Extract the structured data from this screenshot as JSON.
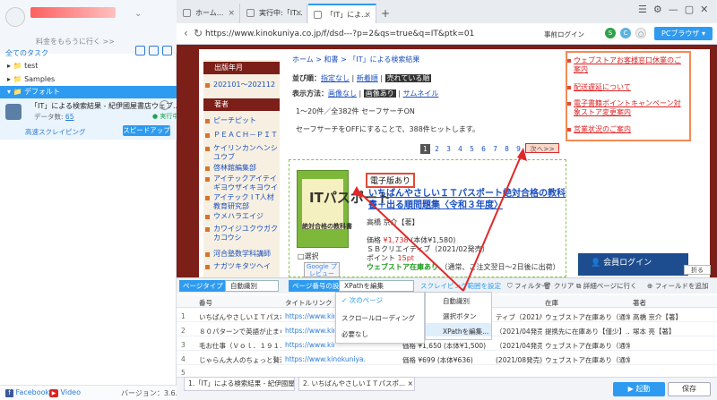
{
  "sidebar": {
    "promo": "料金をもらうに行く >>",
    "section_title": "全てのタスク",
    "tree": [
      {
        "label": "▸ 📁 test"
      },
      {
        "label": "▸ 📁 Samples"
      },
      {
        "label": "▾ 📁 デフォルト"
      }
    ],
    "task": {
      "title": "「IT」による検索結果 - 紀伊國屋書店ウェブ...",
      "count_label": "データ数:",
      "count": "65",
      "status": "● 実行中",
      "cloud": "高速スクレイピング",
      "speed_button": "スピードアップ"
    },
    "footer": {
      "facebook": "Facebook",
      "video": "Video",
      "version": "バージョン：3.6.1"
    }
  },
  "browser": {
    "tabs": [
      {
        "label": "ホーム..."
      },
      {
        "label": "実行中:「IT..."
      },
      {
        "label": "「IT」によ..."
      }
    ],
    "url": "https://www.kinokuniya.co.jp/f/dsd---?p=2&qs=true&q=IT&ptk=01",
    "login_label": "事前ログイン",
    "pc_browser": "PCブラウザ ▾"
  },
  "web": {
    "breadcrumb": "ホーム > 和書 > 「IT」による検索結果",
    "sort_label": "並び順：",
    "sort_items": [
      "指定なし",
      "新着順",
      "売れている順"
    ],
    "display_label": "表示方法：",
    "display_items": [
      "画像なし",
      "画像あり",
      "サムネイル"
    ],
    "range_text": "1〜20件／全382件  セーフサーチON",
    "safe_text": "セーフサーチをOFFにすることで、388件ヒットします。",
    "pager": [
      "1",
      "2",
      "3",
      "4",
      "5",
      "6",
      "7",
      "8",
      "9"
    ],
    "pager_next": "次へ>>",
    "categories": [
      {
        "heading": "出版年月",
        "links": [
          "202101〜202112"
        ]
      },
      {
        "heading": "著者",
        "links": [
          "ピーチピット",
          "ＰＥＡＣＨ－ＰＩＴ",
          "ケイリンカンヘンシユウブ",
          "啓林館編集部",
          "アイテックアイテイギヨウザイキヨウイ",
          "アイテック I T人材教育研究部",
          "ウメハラエイジ",
          "カワイジユクウガクカコウシ",
          "河合塾数学科講師",
          "ナガツキタツヘイ"
        ]
      }
    ],
    "book": {
      "cover_title": "ITパスポート",
      "cover_sub": "絶対合格の教科書",
      "ebook_badge": "電子版あり",
      "title": "いちばんやさしいＩＴパスポート絶対合格の教科書＋出る順問題集〈令和３年度〉",
      "author": "高橋 京介【著】",
      "price_label": "価格",
      "price": "¥1,738",
      "price_tax": "(本体¥1,580)",
      "publisher": "ＳＢクリエイティブ（2021/02発売）",
      "point_label": "ポイント",
      "point": "15pt",
      "stock": "ウェブストア在庫あり",
      "stock_note": "（通常、ご注文翌日〜2日後に出荷）",
      "select": "□選択",
      "google": "Google プレビュー"
    },
    "notices": [
      "ウェブストアお客様窓口休業のご案内",
      "配送遅延について",
      "電子書籍ポイントキャンペーン対象ストア変更案内",
      "営業状況のご案内"
    ],
    "member": "👤 会員ログイン",
    "fold": "折る"
  },
  "panel": {
    "page_type_label": "ページタイプ",
    "page_type_value": "自動識別",
    "page_number_label": "ページ番号の設定",
    "page_number_value": "XPathを編集",
    "scrape_range": "スクレイピング範囲を設定",
    "filter": "フィルター",
    "clear": "クリア",
    "detail": "詳細ページに行く",
    "add_field": "フィールドを追加",
    "columns": [
      "番号",
      "タイトルリンク",
      "",
      "",
      "",
      "在庫",
      "著者"
    ],
    "rows": [
      {
        "n": "1",
        "title": "いちばんやさしいＩＴパスポ...",
        "url": "https://www.kinokuniya.co.jp/f/...",
        "col5": "ティブ（2021/02発...",
        "stock": "ウェブストア在庫あり（通常...",
        "author": "高橋 京介【著】"
      },
      {
        "n": "2",
        "title": "８０パターンで英語が止まら...",
        "url": "https://www.kinokuniya.co.jp/f/...",
        "col5": "（2021/04発売）",
        "stock": "提携先に在庫あり【僅少】...",
        "author": "塚本 亮【著】"
      },
      {
        "n": "3",
        "title": "毛お仕事（Ｖｏｌ．１９１...",
        "url": "https://www.kinokuniya.co.jp/f/...",
        "col5": "（2021/04発売）",
        "stock": "ウェブストア在庫あり（通常...",
        "author": ""
      },
      {
        "n": "4",
        "title": "じゃらん大人のちょっと贅沢...",
        "url": "https://www.kinokuniya.co.jp/f/...",
        "col5": "(2021/08発売)",
        "stock": "ウェブストア在庫あり（通常...",
        "author": ""
      },
      {
        "n": "5",
        "title": "",
        "url": "",
        "col5": "",
        "stock": "",
        "author": ""
      }
    ],
    "price_snippets": [
      "価格 ¥1,650 (本体¥1,500)",
      "価格 ¥699 (本体¥636)"
    ],
    "menu": [
      {
        "label": "✓ 次のページ"
      },
      {
        "label": "スクロールローディング"
      },
      {
        "label": "必要なし"
      }
    ],
    "submenu": [
      {
        "label": "自動識別"
      },
      {
        "label": "選択ボタン"
      },
      {
        "label": "XPathを編集..."
      }
    ]
  },
  "bottom": {
    "tabs": [
      "1.「IT」による検索結果 - 紀伊國屋...",
      "2. いちばんやさしいＩＴパスポ... ×"
    ],
    "start": "▶ 起動",
    "save": "保存"
  }
}
